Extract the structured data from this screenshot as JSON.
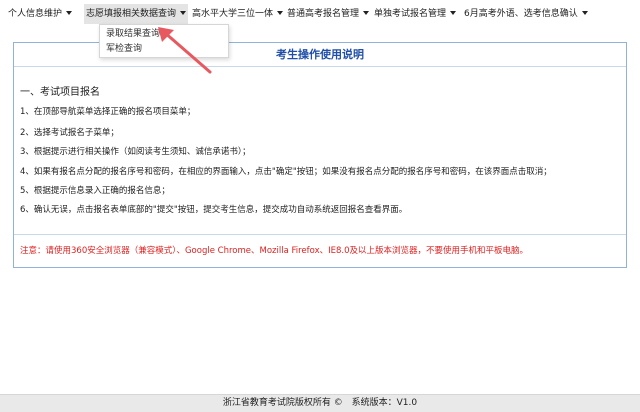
{
  "navbar": {
    "items": [
      {
        "label": "个人信息维护"
      },
      {
        "label": "志愿填报相关数据查询"
      },
      {
        "label": "高水平大学三位一体"
      },
      {
        "label": "普通高考报名管理"
      },
      {
        "label": "单独考试报名管理"
      },
      {
        "label": "6月高考外语、选考信息确认"
      }
    ]
  },
  "dropdown": {
    "items": [
      {
        "label": "录取结果查询"
      },
      {
        "label": "军检查询"
      }
    ]
  },
  "instructions": {
    "title": "考生操作使用说明",
    "section_heading": "一、考试项目报名",
    "steps": [
      "1、在顶部导航菜单选择正确的报名项目菜单；",
      "2、选择考试报名子菜单；",
      "3、根据提示进行相关操作（如阅读考生须知、诚信承诺书）；",
      "4、如果有报名点分配的报名序号和密码，在相应的界面输入，点击\"确定\"按钮；如果没有报名点分配的报名序号和密码，在该界面点击取消；",
      "5、根据提示信息录入正确的报名信息；",
      "6、确认无误，点击报名表单底部的\"提交\"按钮，提交考生信息，提交成功自动系统返回报名查看界面。"
    ],
    "notice": "注意：请使用360安全浏览器（兼容模式）、Google Chrome、Mozilla Firefox、IE8.0及以上版本浏览器，不要使用手机和平板电脑。"
  },
  "footer": {
    "copyright": "浙江省教育考试院版权所有 ©",
    "version": "系统版本：V1.0"
  },
  "colors": {
    "title_blue": "#1f4fa8",
    "notice_red": "#e02020",
    "arrow_red": "#e8585f",
    "panel_border": "#8fb3d9"
  }
}
